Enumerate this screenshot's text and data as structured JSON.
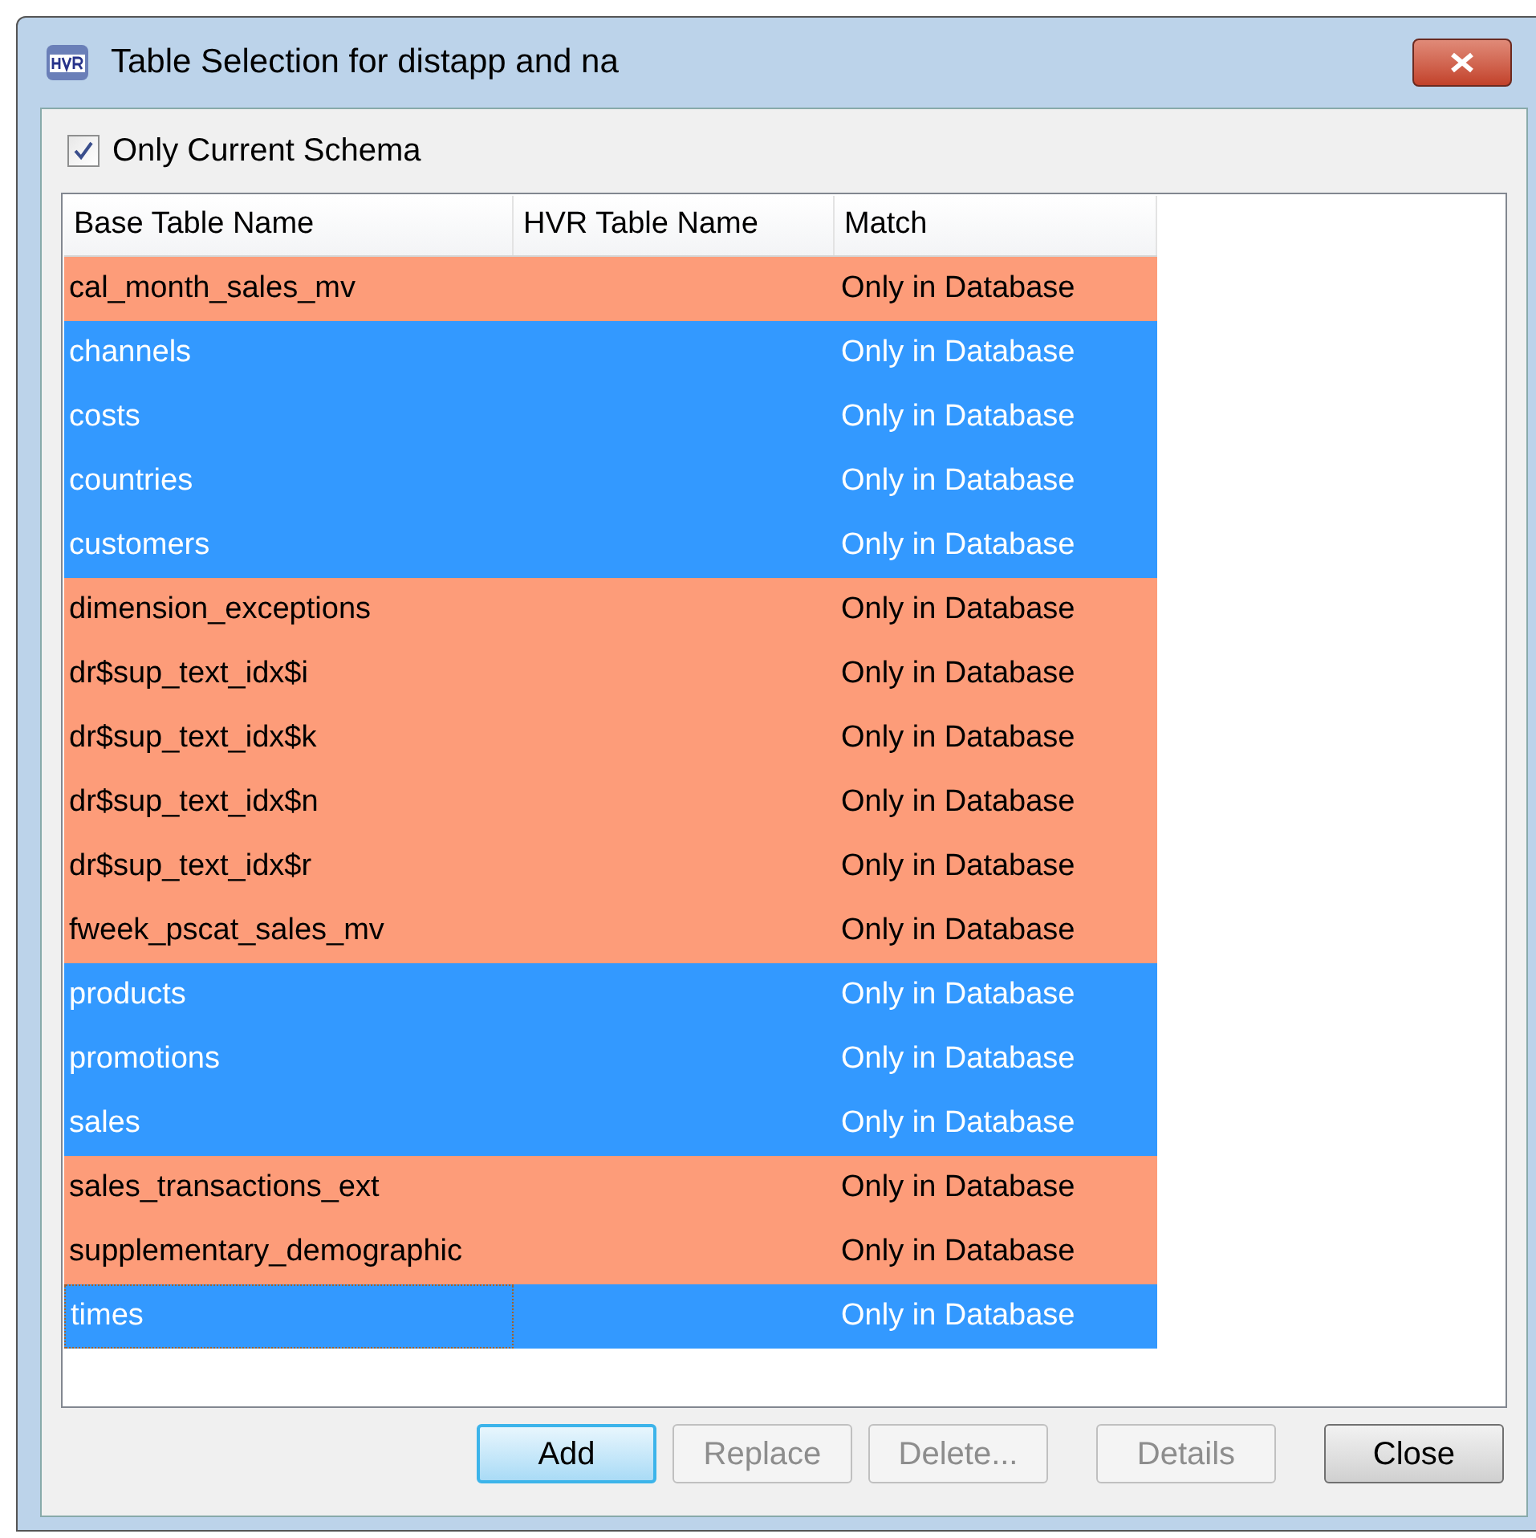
{
  "window": {
    "title": "Table Selection for distapp and na"
  },
  "only_current_schema": {
    "label": "Only Current Schema",
    "checked": true
  },
  "table": {
    "columns": [
      "Base Table Name",
      "HVR Table Name",
      "Match"
    ],
    "rows": [
      {
        "base": "cal_month_sales_mv",
        "match": "Only in Database",
        "selected": false
      },
      {
        "base": "channels",
        "match": "Only in Database",
        "selected": true
      },
      {
        "base": "costs",
        "match": "Only in Database",
        "selected": true
      },
      {
        "base": "countries",
        "match": "Only in Database",
        "selected": true
      },
      {
        "base": "customers",
        "match": "Only in Database",
        "selected": true
      },
      {
        "base": "dimension_exceptions",
        "match": "Only in Database",
        "selected": false
      },
      {
        "base": "dr$sup_text_idx$i",
        "match": "Only in Database",
        "selected": false
      },
      {
        "base": "dr$sup_text_idx$k",
        "match": "Only in Database",
        "selected": false
      },
      {
        "base": "dr$sup_text_idx$n",
        "match": "Only in Database",
        "selected": false
      },
      {
        "base": "dr$sup_text_idx$r",
        "match": "Only in Database",
        "selected": false
      },
      {
        "base": "fweek_pscat_sales_mv",
        "match": "Only in Database",
        "selected": false
      },
      {
        "base": "products",
        "match": "Only in Database",
        "selected": true
      },
      {
        "base": "promotions",
        "match": "Only in Database",
        "selected": true
      },
      {
        "base": "sales",
        "match": "Only in Database",
        "selected": true
      },
      {
        "base": "sales_transactions_ext",
        "match": "Only in Database",
        "selected": false
      },
      {
        "base": "supplementary_demographic",
        "match": "Only in Database",
        "selected": false
      },
      {
        "base": "times",
        "match": "Only in Database",
        "selected": true,
        "focused": true
      }
    ]
  },
  "buttons": [
    {
      "label": "Add",
      "disabled": false,
      "default": true
    },
    {
      "label": "Replace",
      "disabled": true,
      "default": false
    },
    {
      "label": "Delete...",
      "disabled": true,
      "default": false
    },
    {
      "label": "Details",
      "disabled": true,
      "default": false
    },
    {
      "label": "Close",
      "disabled": false,
      "default": false
    }
  ]
}
